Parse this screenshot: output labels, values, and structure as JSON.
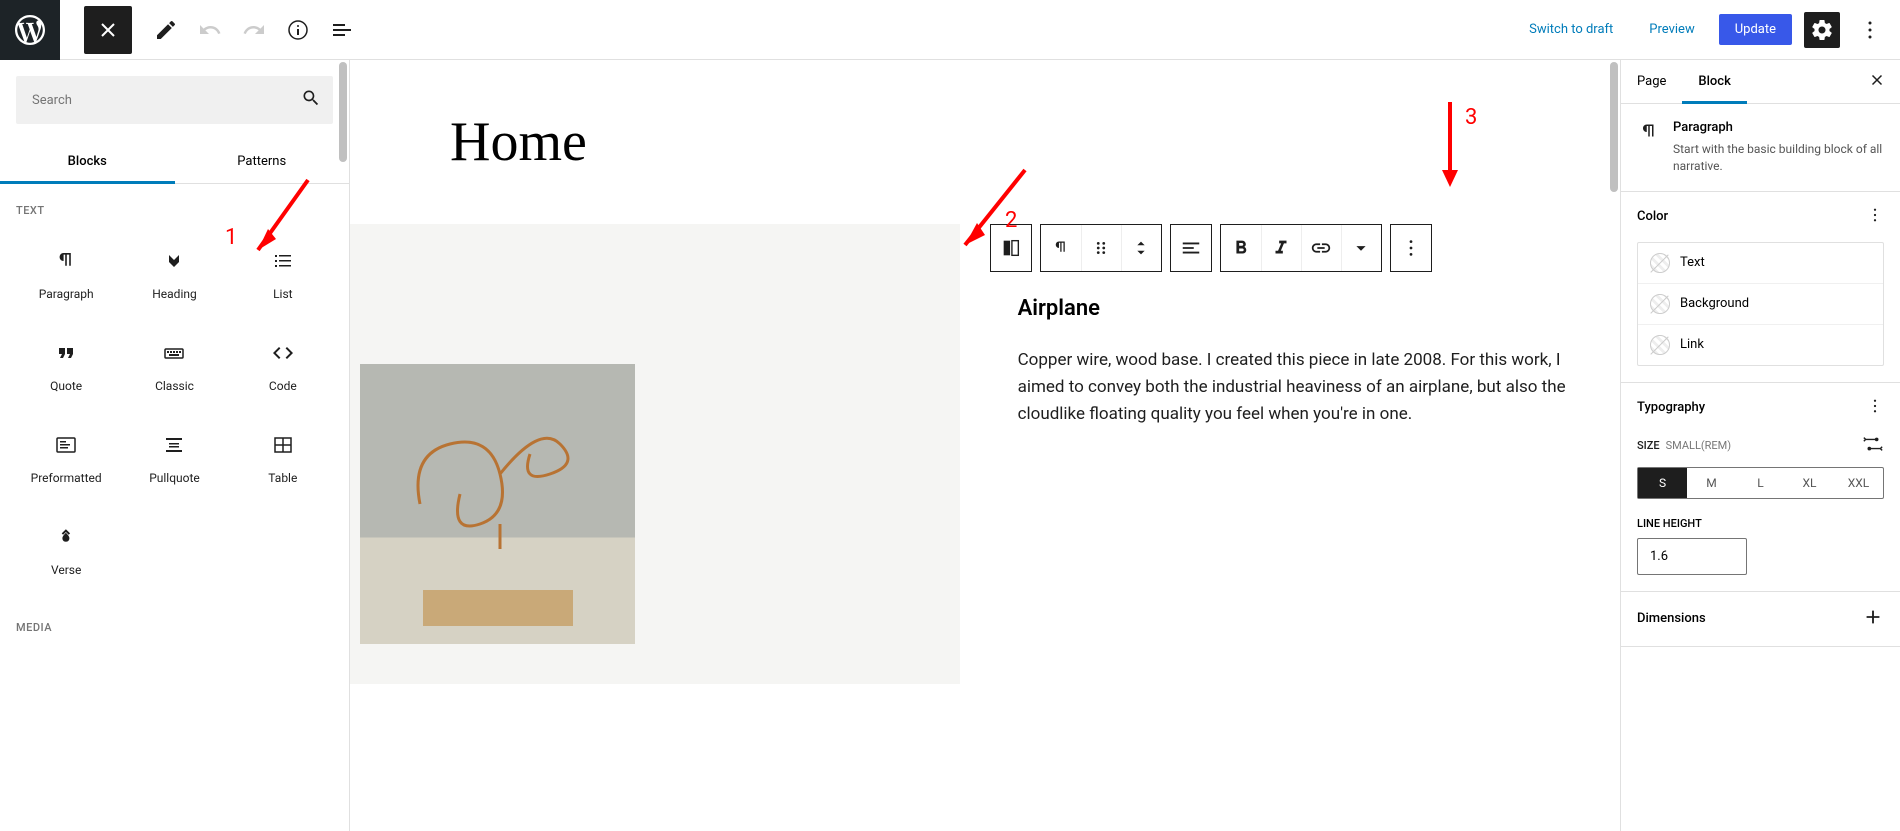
{
  "topbar": {
    "switch_to_draft": "Switch to draft",
    "preview": "Preview",
    "update": "Update"
  },
  "inserter": {
    "search_placeholder": "Search",
    "tabs": {
      "blocks": "Blocks",
      "patterns": "Patterns"
    },
    "categories": {
      "text": "TEXT",
      "media": "MEDIA"
    },
    "blocks": {
      "paragraph": "Paragraph",
      "heading": "Heading",
      "list": "List",
      "quote": "Quote",
      "classic": "Classic",
      "code": "Code",
      "preformatted": "Preformatted",
      "pullquote": "Pullquote",
      "table": "Table",
      "verse": "Verse"
    }
  },
  "page": {
    "title": "Home",
    "block_heading": "Airplane",
    "block_text": "Copper wire, wood base. I created this piece in late 2008. For this work, I aimed to convey both the industrial heaviness of an airplane, but also the cloudlike floating quality you feel when you're in one."
  },
  "sidebar": {
    "tabs": {
      "page": "Page",
      "block": "Block"
    },
    "block_title": "Paragraph",
    "block_desc": "Start with the basic building block of all narrative.",
    "color": {
      "title": "Color",
      "text": "Text",
      "background": "Background",
      "link": "Link"
    },
    "typography": {
      "title": "Typography",
      "size_label": "SIZE",
      "size_unit": "SMALL(REM)",
      "sizes": [
        "S",
        "M",
        "L",
        "XL",
        "XXL"
      ],
      "line_height_label": "LINE HEIGHT",
      "line_height_value": "1.6"
    },
    "dimensions": {
      "title": "Dimensions"
    }
  },
  "annotations": {
    "n1": "1",
    "n2": "2",
    "n3": "3"
  }
}
